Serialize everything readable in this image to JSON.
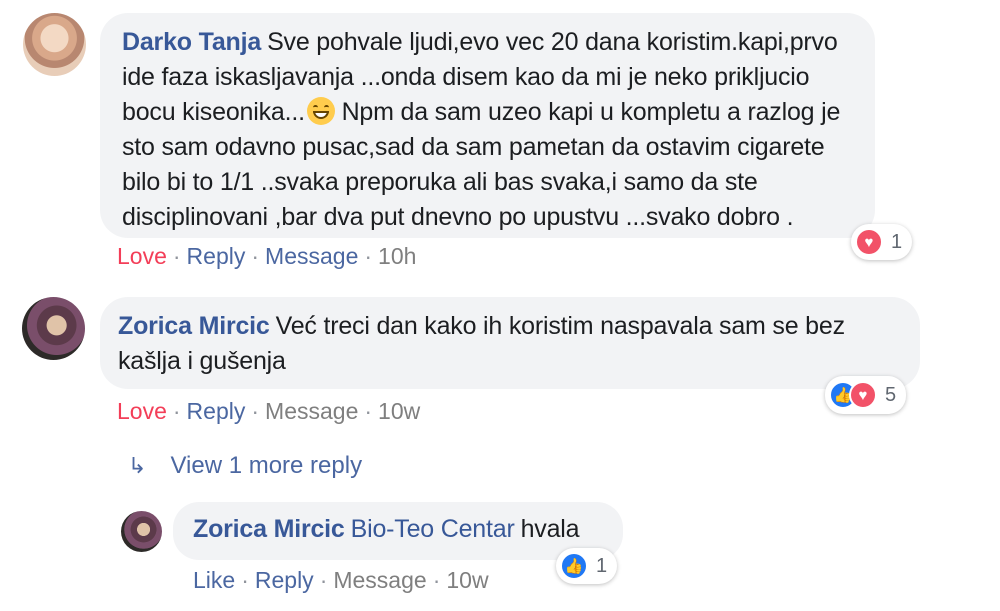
{
  "comments": [
    {
      "author": "Darko Tanja",
      "text_before_emoji": "Sve pohvale ljudi,evo vec 20 dana koristim.kapi,prvo ide faza iskasljavanja ...onda disem kao da mi je neko prikljucio bocu kiseonika...",
      "emoji": "grinning-face-emoji",
      "text_after_emoji": " Npm da sam uzeo kapi u kompletu a razlog je sto sam odavno pusac,sad da sam pametan da ostavim cigarete bilo bi to 1/1 ..svaka preporuka ali bas svaka,i samo da ste disciplinovani ,bar dva put dnevno po upustvu ...svako dobro .",
      "actions": {
        "love": "Love",
        "reply": "Reply",
        "message": "Message",
        "time": "10h"
      },
      "reactions": {
        "icons": [
          "love-reaction-icon"
        ],
        "count": "1"
      }
    },
    {
      "author": "Zorica Mircic",
      "text": "Već treci dan kako ih koristim naspavala sam se bez kašlja i gušenja",
      "actions": {
        "love": "Love",
        "reply": "Reply",
        "message": "Message",
        "time": "10w"
      },
      "reactions": {
        "icons": [
          "like-reaction-icon",
          "love-reaction-icon"
        ],
        "count": "5"
      }
    }
  ],
  "view_more": {
    "icon": "reply-arrow-icon",
    "label": "View 1 more reply"
  },
  "reply": {
    "author": "Zorica Mircic",
    "mention": "Bio-Teo Centar",
    "text": "hvala",
    "actions": {
      "like": "Like",
      "reply": "Reply",
      "message": "Message",
      "time": "10w"
    },
    "reactions": {
      "icons": [
        "like-reaction-icon"
      ],
      "count": "1"
    }
  },
  "colors": {
    "author": "#385898",
    "love": "#f33e58",
    "link": "#4b67a1",
    "bubble": "#f2f3f5",
    "like_reaction": "#2078f4",
    "love_reaction": "#f25268"
  },
  "separator": "·"
}
